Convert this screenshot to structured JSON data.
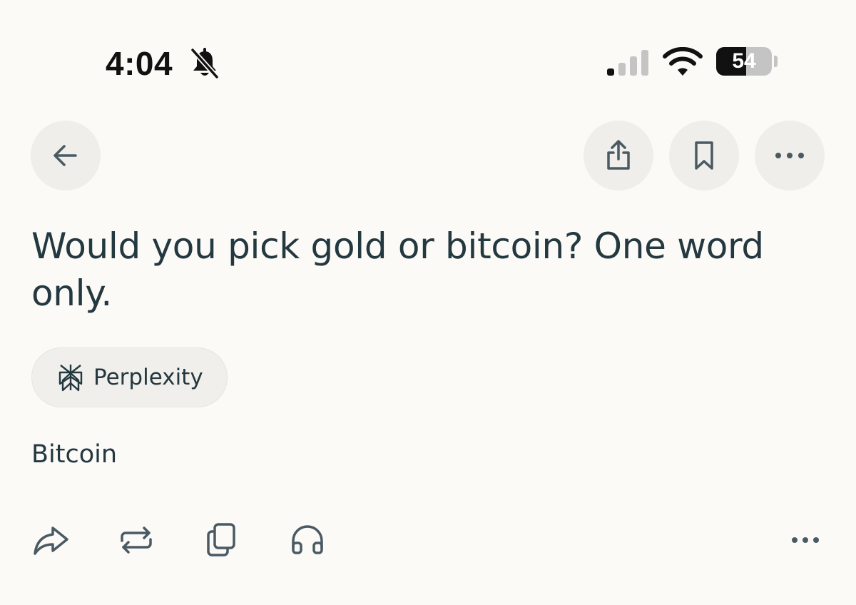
{
  "status_bar": {
    "time": "4:04",
    "battery_percent": "54",
    "battery_level": 0.54,
    "icons": [
      "bell-slash-icon",
      "cellular-signal-icon",
      "wifi-icon",
      "battery-icon"
    ]
  },
  "header": {
    "icons": [
      "back-arrow-icon",
      "share-icon",
      "bookmark-icon",
      "more-icon"
    ]
  },
  "thread": {
    "question": "Would you pick gold or bitcoin?  One word only.",
    "source_label": "Perplexity",
    "source_icon": "perplexity-logo-icon",
    "answer": "Bitcoin"
  },
  "actions": {
    "icons": [
      "forward-share-icon",
      "rewrite-icon",
      "copy-icon",
      "listen-headphones-icon",
      "more-icon"
    ]
  },
  "colors": {
    "background": "#fbfaf7",
    "button_background": "#efeeea",
    "text": "#243840",
    "icon": "#4a5a63"
  }
}
